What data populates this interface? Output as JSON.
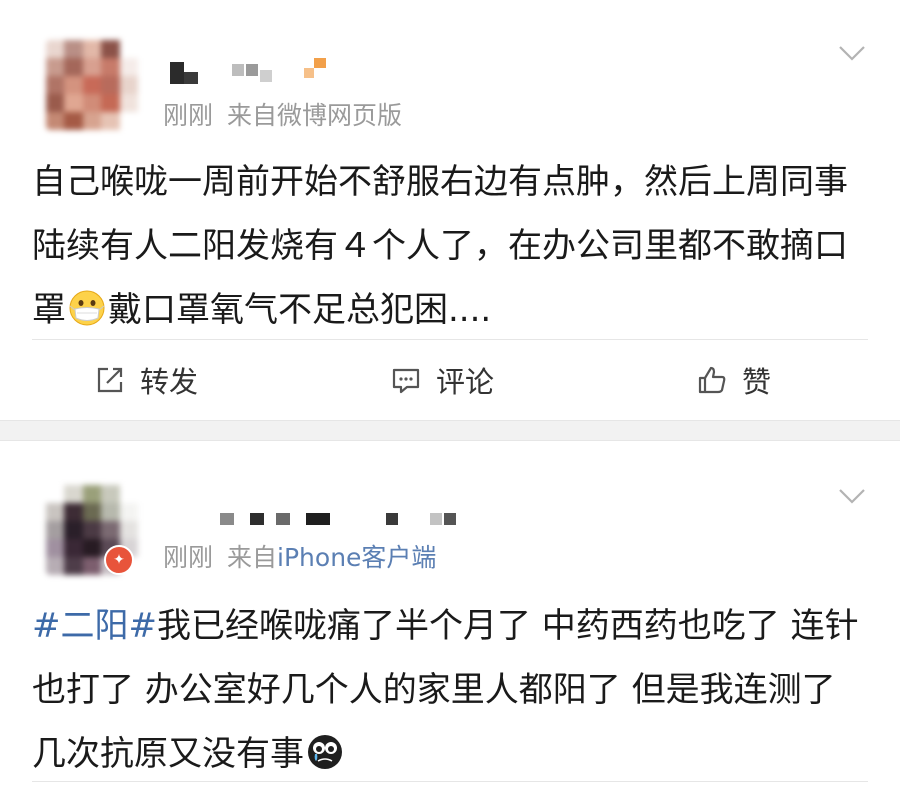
{
  "posts": [
    {
      "timestamp": "刚刚",
      "source_prefix": "来自",
      "source_device": "微博网页版",
      "content": "自己喉咙一周前开始不舒服右边有点肿，然后上周同事陆续有人二阳发烧有４个人了，在办公司里都不敢摘口罩",
      "emoji": "mask-face-emoji",
      "content_after_emoji": "戴口罩氧气不足总犯困....",
      "actions": {
        "repost_label": "转发",
        "comment_label": "评论",
        "like_label": "赞"
      }
    },
    {
      "timestamp": "刚刚",
      "source_prefix": "来自",
      "source_device": "iPhone客户端",
      "hashtag": "#二阳#",
      "content": "我已经喉咙痛了半个月了 中药西药也吃了 连针也打了 办公室好几个人的家里人都阳了 但是我连测了几次抗原又没有事",
      "emoji": "crying-face-emoji",
      "vip_badge_icon": "vip-badge-icon"
    }
  ],
  "colors": {
    "meta_gray": "#9a9a9a",
    "hashtag_blue": "#3d6aa8",
    "device_link_blue": "#5b7fb3",
    "section_gap": "#f2f2f2"
  }
}
